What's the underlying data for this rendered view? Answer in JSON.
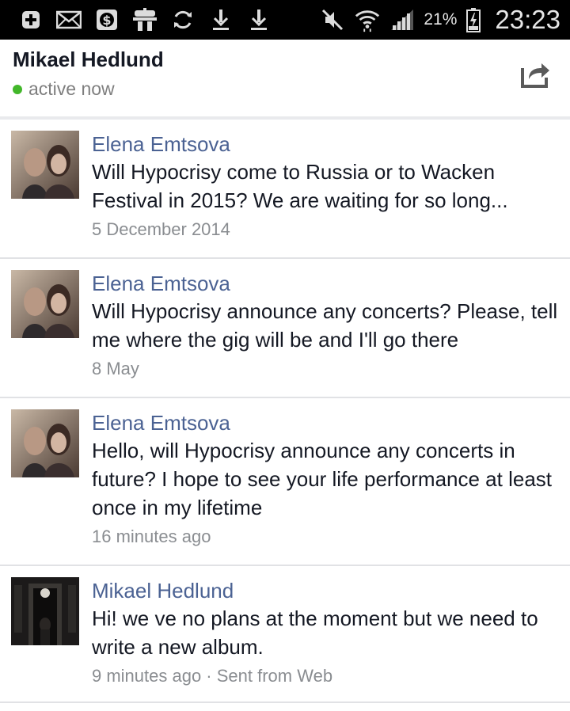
{
  "status_bar": {
    "left_icons": [
      "add-icon",
      "mail-icon",
      "sms-icon",
      "robot-icon",
      "sync-icon",
      "download-icon",
      "download-icon"
    ],
    "right_icons": [
      "mute-icon",
      "wifi-icon",
      "signal-icon",
      "battery-charging-icon"
    ],
    "battery_percent": "21%",
    "time": "23:23"
  },
  "header": {
    "title": "Mikael Hedlund",
    "presence": "active now",
    "presence_color": "#42b72a"
  },
  "messages": [
    {
      "sender": "Elena Emtsova",
      "text": "Will Hypocrisy come to Russia or to Wacken Festival in 2015? We are waiting for so long...",
      "time": "5 December 2014",
      "avatar": "couple-photo"
    },
    {
      "sender": "Elena Emtsova",
      "text": "Will Hypocrisy announce any concerts? Please, tell me where the gig will be and I'll go there",
      "time": "8 May",
      "avatar": "couple-photo"
    },
    {
      "sender": "Elena Emtsova",
      "text": "Hello, will Hypocrisy announce any concerts in future? I hope to see your life performance at least once in my lifetime",
      "time": "16 minutes ago",
      "avatar": "couple-photo"
    },
    {
      "sender": "Mikael Hedlund",
      "text": "Hi! we ve no plans at the moment but we need to write a new album.",
      "time": "9 minutes ago · Sent from Web",
      "avatar": "dark-doorway-photo"
    }
  ],
  "colors": {
    "sender_name": "#4b6293",
    "message_text": "#141823",
    "meta_text": "#8a8d91",
    "status_bar_bg": "#000000"
  }
}
